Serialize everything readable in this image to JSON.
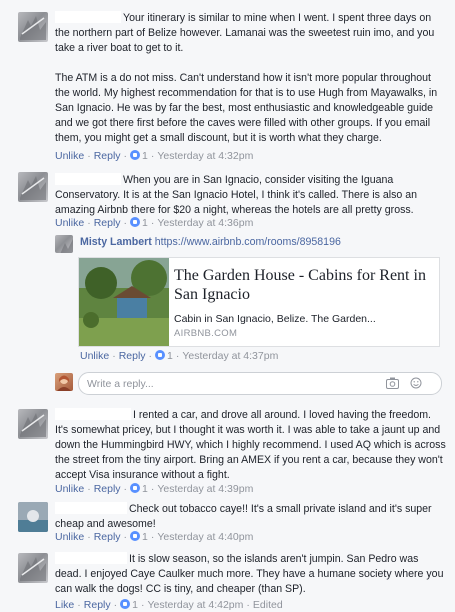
{
  "actions": {
    "unlike": "Unlike",
    "reply": "Reply",
    "like": "Like",
    "separator": "·"
  },
  "comments": [
    {
      "paragraphs": [
        "Your itinerary is similar to mine when I went. I spent three days on the northern part of Belize however. Lamanai was the sweetest ruin imo, and you take a river boat to get to it.",
        "The ATM is a do not miss. Can't understand how it isn't more popular throughout the world. My highest recommendation for that is to use Hugh from Mayawalks, in San Ignacio. He was by far the best, most enthusiastic and knowledgeable guide and we got there first before the caves were filled with other groups. If you email them, you might get a small discount, but it is worth what they charge."
      ],
      "like_count": "1",
      "timestamp": "Yesterday at 4:32pm"
    },
    {
      "paragraphs": [
        "When you are in San Ignacio, consider visiting the Iguana Conservatory. It is at the San Ignacio Hotel, I think it's called. There is also an amazing Airbnb there for $20 a night, whereas the hotels are all pretty gross."
      ],
      "like_count": "1",
      "timestamp": "Yesterday at 4:36pm"
    },
    {
      "paragraphs": [
        "I rented a car, and drove all around. I loved having the freedom. It's somewhat pricey, but I thought it was worth it. I was able to take a jaunt up and down the Hummingbird HWY, which I highly recommend. I used AQ which is across the street from the tiny airport. Bring an AMEX if you rent a car, because they won't accept Visa insurance without a fight."
      ],
      "like_count": "1",
      "timestamp": "Yesterday at 4:39pm"
    },
    {
      "paragraphs": [
        "Check out tobacco caye!! It's a small private island and it's super cheap and awesome!"
      ],
      "like_count": "1",
      "timestamp": "Yesterday at 4:40pm"
    },
    {
      "paragraphs": [
        "It is slow season, so the islands aren't jumpin. San Pedro was dead. I enjoyed Caye Caulker much more. They have a humane society where you can walk the dogs! CC is tiny, and cheaper (than SP)."
      ],
      "like_count": "1",
      "timestamp": "Yesterday at 4:42pm",
      "edited": "Edited"
    }
  ],
  "nested_reply": {
    "author": "Misty Lambert",
    "url": "https://www.airbnb.com/rooms/8958196",
    "card": {
      "title": "The Garden House - Cabins for Rent in San Ignacio",
      "description": "Cabin in San Ignacio, Belize. The Garden...",
      "domain": "AIRBNB.COM"
    },
    "like_count": "1",
    "timestamp": "Yesterday at 4:37pm"
  },
  "reply_box": {
    "placeholder": "Write a reply..."
  },
  "colors": {
    "link": "#4b67a1",
    "meta": "#90949c",
    "like_badge": "#5890ff",
    "background": "#f6f7f9"
  }
}
